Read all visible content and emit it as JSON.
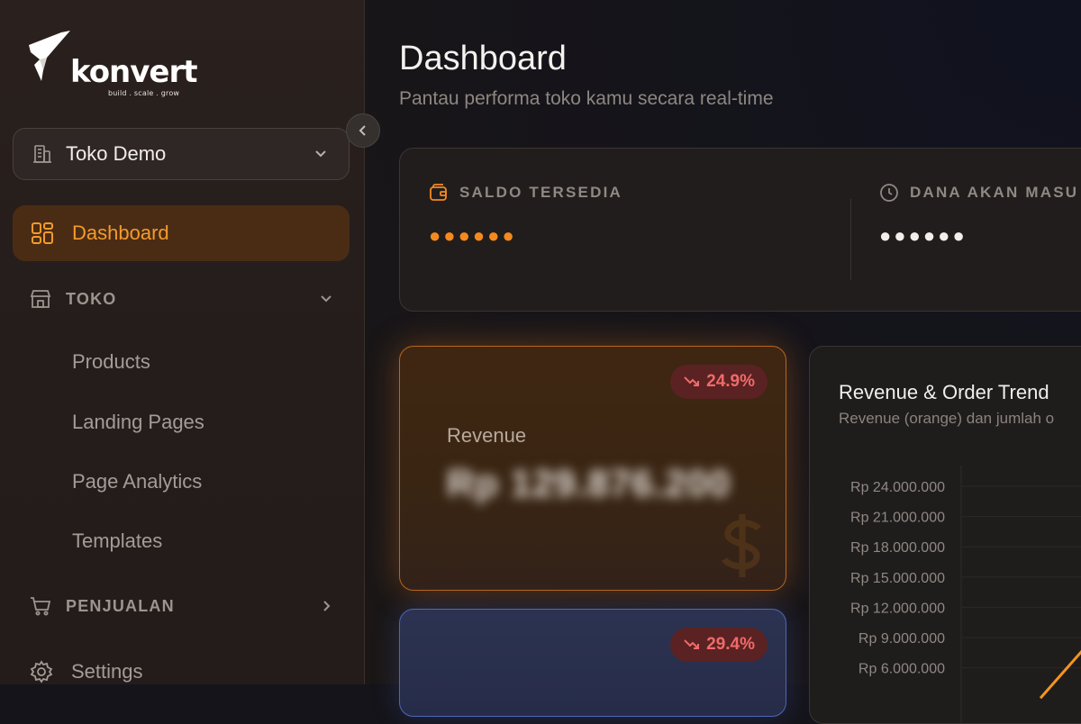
{
  "brand": {
    "name": "konvert",
    "tagline": "build . scale . grow"
  },
  "sidebar": {
    "store_selector": {
      "label": "Toko Demo"
    },
    "active_item": {
      "label": "Dashboard"
    },
    "sections": [
      {
        "label": "TOKO",
        "items": [
          "Products",
          "Landing Pages",
          "Page Analytics",
          "Templates"
        ]
      },
      {
        "label": "PENJUALAN"
      }
    ],
    "settings": {
      "label": "Settings"
    }
  },
  "header": {
    "title": "Dashboard",
    "subtitle": "Pantau performa toko kamu secara real-time"
  },
  "balances": {
    "available": {
      "label": "SALDO TERSEDIA",
      "value": "●●●●●●"
    },
    "incoming": {
      "label": "DANA AKAN MASU",
      "value": "●●●●●●"
    }
  },
  "stat_cards": {
    "revenue": {
      "label": "Revenue",
      "change": "24.9%",
      "value": "Rp 129.876.200"
    },
    "second": {
      "change": "29.4%"
    }
  },
  "chart": {
    "title": "Revenue & Order Trend",
    "subtitle": "Revenue (orange) dan jumlah o"
  },
  "chart_data": {
    "type": "line",
    "title": "Revenue & Order Trend",
    "subtitle": "Revenue (orange) dan jumlah o",
    "y_tick_labels": [
      "Rp 24.000.000",
      "Rp 21.000.000",
      "Rp 18.000.000",
      "Rp 15.000.000",
      "Rp 12.000.000",
      "Rp 9.000.000",
      "Rp 6.000.000"
    ],
    "y_ticks": [
      24000000,
      21000000,
      18000000,
      15000000,
      12000000,
      9000000,
      6000000
    ],
    "ylim": [
      6000000,
      24000000
    ],
    "grid": true,
    "series": [
      {
        "color": "#f5941d",
        "visible_segment": [
          [
            0.0,
            3000000
          ],
          [
            1.0,
            11500000
          ]
        ]
      }
    ]
  },
  "colors": {
    "accent": "#f59a2c",
    "danger": "#f06a6a",
    "orange_dots": "#f38a1e"
  }
}
